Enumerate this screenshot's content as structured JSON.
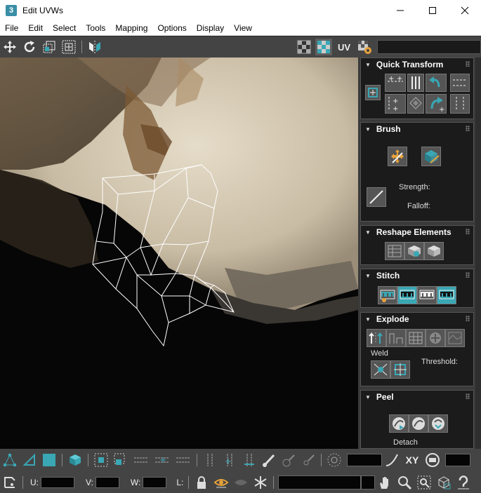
{
  "window": {
    "title": "Edit UVWs",
    "app_icon_text": "3",
    "minimize_icon": "minimize-icon",
    "maximize_icon": "maximize-icon",
    "close_icon": "close-icon"
  },
  "menu": [
    "File",
    "Edit",
    "Select",
    "Tools",
    "Mapping",
    "Options",
    "Display",
    "View"
  ],
  "toolbar_top": {
    "uv_label": "UV"
  },
  "panel": {
    "quick_transform": {
      "title": "Quick Transform"
    },
    "brush": {
      "title": "Brush",
      "strength_label": "Strength:",
      "falloff_label": "Falloff:"
    },
    "reshape": {
      "title": "Reshape Elements"
    },
    "stitch": {
      "title": "Stitch"
    },
    "explode": {
      "title": "Explode",
      "weld_label": "Weld",
      "threshold_label": "Threshold:"
    },
    "peel": {
      "title": "Peel",
      "detach_label": "Detach"
    }
  },
  "bottom": {
    "xy_label": "XY",
    "u_label": "U:",
    "v_label": "V:",
    "w_label": "W:",
    "l_label": "L:"
  },
  "colors": {
    "accent": "#3aa7b4",
    "panel_bg": "#1b1b1b",
    "toolbar_bg": "#444444"
  }
}
